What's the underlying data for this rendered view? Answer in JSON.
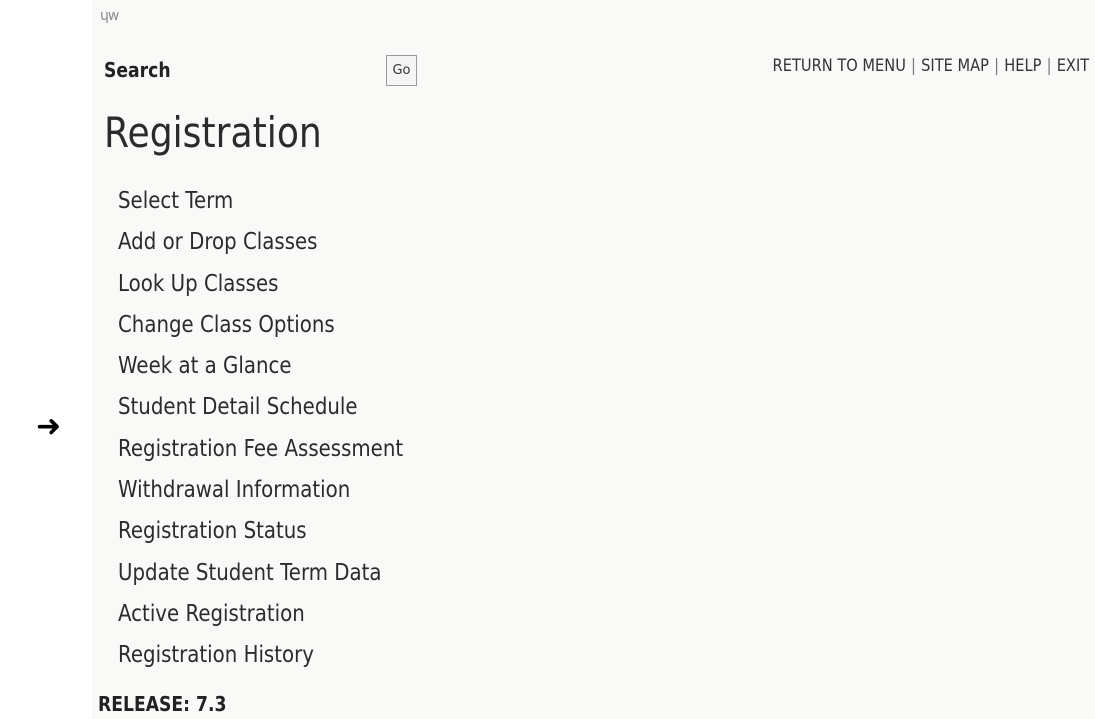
{
  "logo": {
    "text": "␣w"
  },
  "search": {
    "label": "Search",
    "value": "",
    "placeholder": "",
    "button_label": "Go"
  },
  "top_nav": [
    {
      "label": "RETURN TO MENU"
    },
    {
      "label": "SITE MAP"
    },
    {
      "label": "HELP"
    },
    {
      "label": "EXIT"
    }
  ],
  "page_title": "Registration",
  "menu": {
    "items": [
      {
        "label": "Select Term"
      },
      {
        "label": "Add or Drop Classes"
      },
      {
        "label": "Look Up Classes"
      },
      {
        "label": "Change Class Options"
      },
      {
        "label": "Week at a Glance"
      },
      {
        "label": "Student Detail Schedule"
      },
      {
        "label": "Registration Fee Assessment"
      },
      {
        "label": "Withdrawal Information"
      },
      {
        "label": "Registration Status"
      },
      {
        "label": "Update Student Term Data"
      },
      {
        "label": "Active Registration"
      },
      {
        "label": "Registration History"
      }
    ]
  },
  "pointer": {
    "glyph": "➜",
    "target": "Registration Fee Assessment"
  },
  "release": "RELEASE: 7.3"
}
